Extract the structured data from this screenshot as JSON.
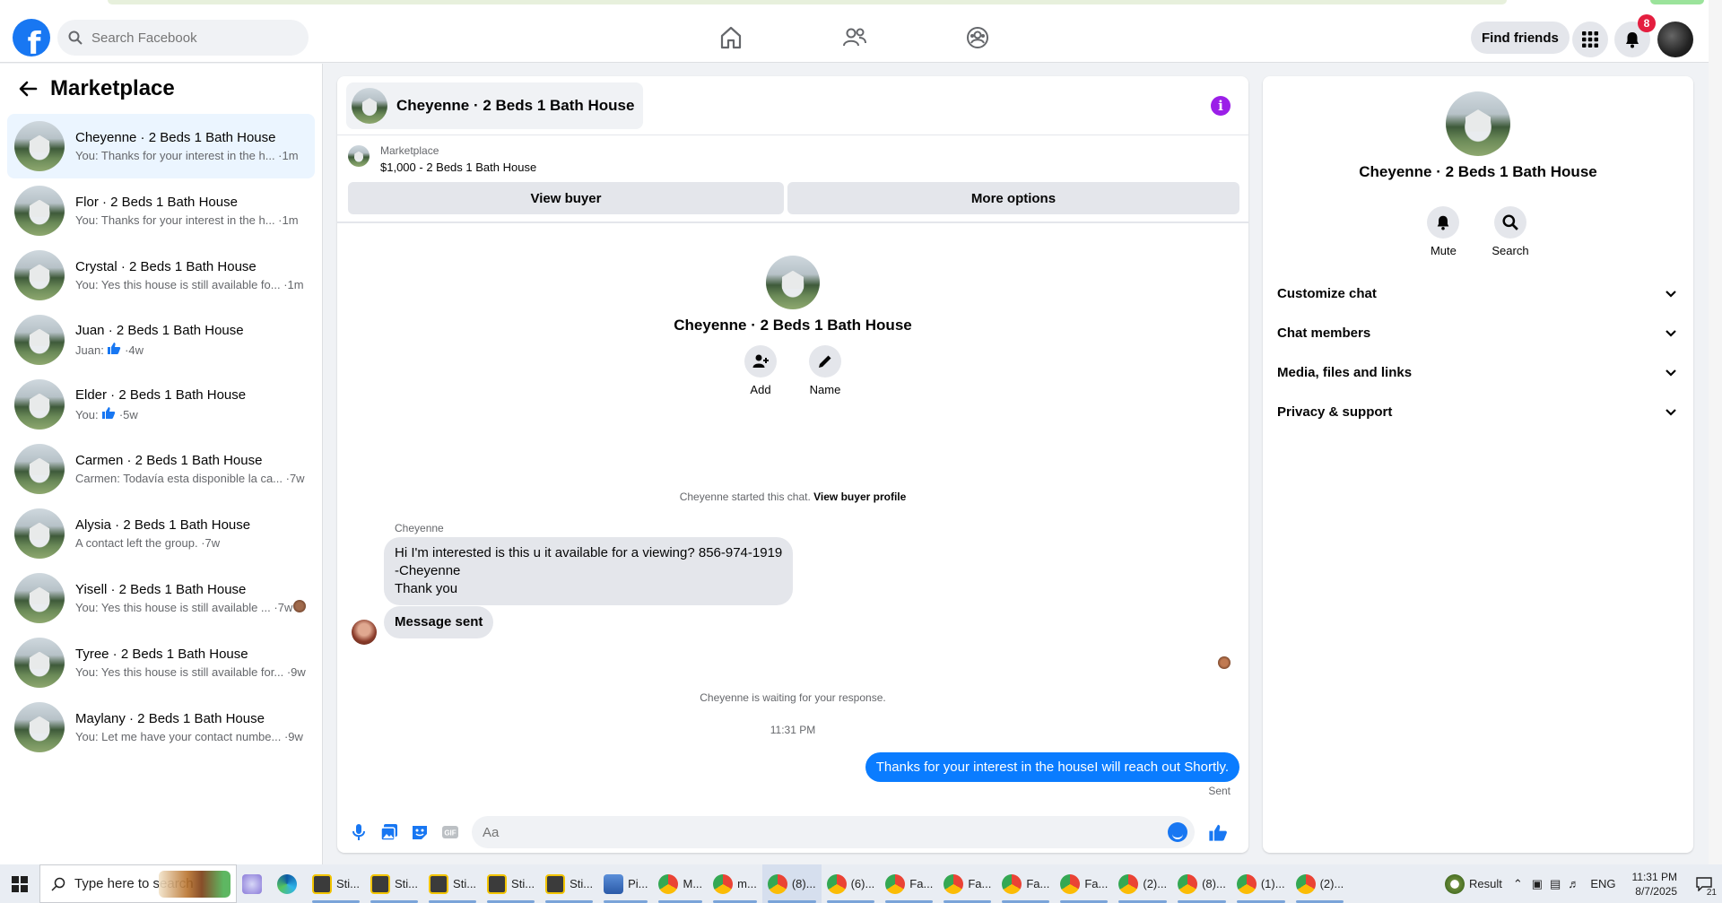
{
  "colors": {
    "brand": "#1877f2",
    "outgoing_bubble": "#0a7cff",
    "info": "#9b1fe8",
    "badge": "#e41e3f"
  },
  "topnav": {
    "logo_letter": "f",
    "search_placeholder": "Search Facebook",
    "icons": [
      "home-icon",
      "friends-icon",
      "groups-icon"
    ],
    "find_friends_label": "Find friends",
    "notifications_count": "8"
  },
  "sidebar": {
    "title": "Marketplace",
    "conversations": [
      {
        "name": "Cheyenne · 2 Beds 1 Bath House",
        "snippet": "You: Thanks for your interest in the h... ·1m",
        "active": true
      },
      {
        "name": "Flor · 2 Beds 1 Bath House",
        "snippet": "You: Thanks for your interest in the h... ·1m"
      },
      {
        "name": "Crystal · 2 Beds 1 Bath House",
        "snippet": "You: Yes this house is still available fo... ·1m"
      },
      {
        "name": "Juan · 2 Beds 1 Bath House",
        "snippet_prefix": "Juan:",
        "snippet_suffix": "·4w"
      },
      {
        "name": "Elder · 2 Beds 1 Bath House",
        "snippet_prefix": "You:",
        "snippet_suffix": "·5w"
      },
      {
        "name": "Carmen · 2 Beds 1 Bath House",
        "snippet": "Carmen: Todavía esta disponible la ca... ·7w"
      },
      {
        "name": "Alysia · 2 Beds 1 Bath House",
        "snippet": "A contact left the group. ·7w"
      },
      {
        "name": "Yisell · 2 Beds 1 Bath House",
        "snippet": "You: Yes this house is still available ... ·7w"
      },
      {
        "name": "Tyree · 2 Beds 1 Bath House",
        "snippet": "You: Yes this house is still available for... ·9w"
      },
      {
        "name": "Maylany · 2 Beds 1 Bath House",
        "snippet": "You: Let me have your contact numbe... ·9w"
      }
    ]
  },
  "chat": {
    "title": "Cheyenne · 2 Beds 1 Bath House",
    "listing_source": "Marketplace",
    "listing_title": "$1,000 - 2 Beds 1 Bath House",
    "view_buyer_label": "View buyer",
    "more_options_label": "More options",
    "intro_title": "Cheyenne · 2 Beds 1 Bath House",
    "add_label": "Add",
    "name_label": "Name",
    "started_text": "Cheyenne started this chat.",
    "view_profile_link": "View buyer profile",
    "sender_name": "Cheyenne",
    "incoming_lines": [
      "Hi I'm interested is this u it available for a viewing? 856-974-1919",
      "-Cheyenne",
      "Thank you"
    ],
    "message_sent": "Message sent",
    "waiting_text": "Cheyenne is waiting for your response.",
    "timestamp": "11:31 PM",
    "outgoing": "Thanks for your interest in the houseI will reach out Shortly.",
    "sent_label": "Sent",
    "composer_placeholder": "Aa"
  },
  "rpanel": {
    "title": "Cheyenne · 2 Beds 1 Bath House",
    "mute_label": "Mute",
    "search_label": "Search",
    "sections": [
      "Customize chat",
      "Chat members",
      "Media, files and links",
      "Privacy & support"
    ]
  },
  "taskbar": {
    "search_placeholder": "Type here to search",
    "apps": [
      "Sti...",
      "Sti...",
      "Sti...",
      "Sti...",
      "Sti...",
      "Pi...",
      "M...",
      "m...",
      "(8)...",
      "(6)...",
      "Fa...",
      "Fa...",
      "Fa...",
      "Fa...",
      "(2)...",
      "(8)...",
      "(1)...",
      "(2)..."
    ],
    "weather": "Result",
    "lang": "ENG",
    "time": "11:31 PM",
    "date": "8/7/2025",
    "notif_count": "21"
  }
}
